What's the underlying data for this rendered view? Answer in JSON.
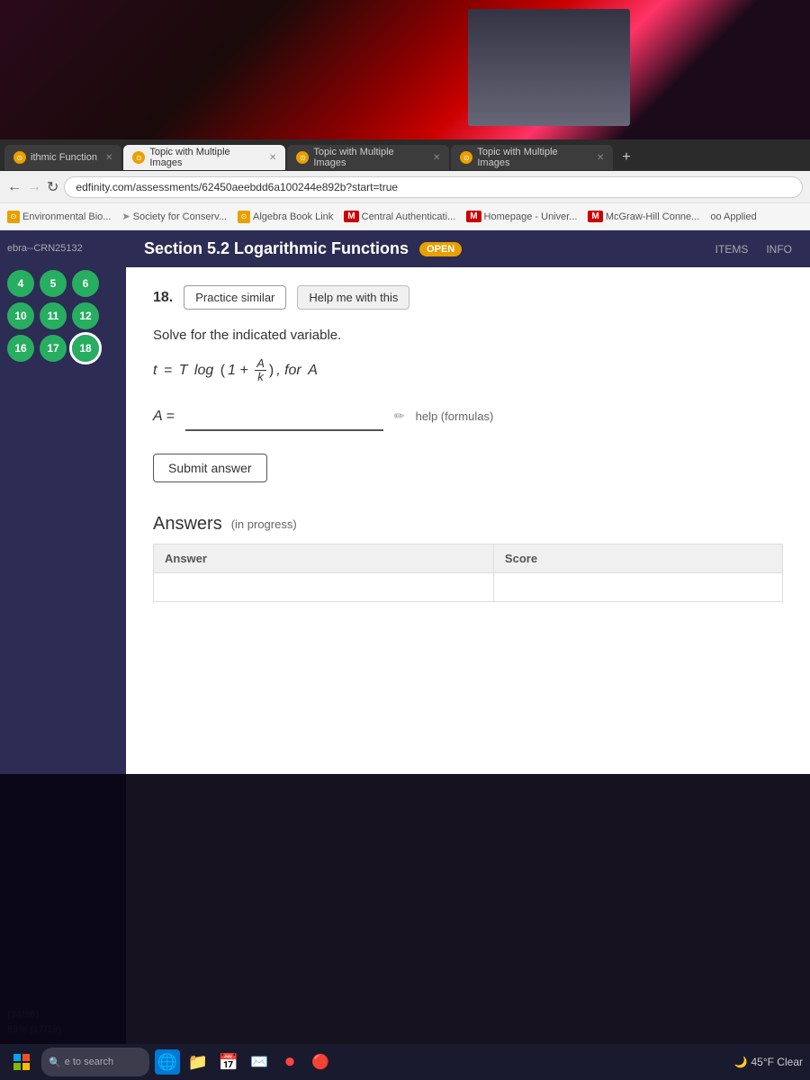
{
  "top_area": {
    "description": "Camera/video background area"
  },
  "browser": {
    "tabs": [
      {
        "id": "tab1",
        "label": "ithmic Function",
        "active": false,
        "closable": true
      },
      {
        "id": "tab2",
        "label": "Topic with Multiple Images",
        "active": true,
        "closable": true
      },
      {
        "id": "tab3",
        "label": "Topic with Multiple Images",
        "active": false,
        "closable": true
      },
      {
        "id": "tab4",
        "label": "Topic with Multiple Images",
        "active": false,
        "closable": true
      }
    ],
    "address": "edfinity.com/assessments/62450aeebdd6a100244e892b?start=true",
    "bookmarks": [
      {
        "label": "Environmental Bio..."
      },
      {
        "label": "Society for Conserv..."
      },
      {
        "label": "Algebra Book Link"
      },
      {
        "label": "Central Authenticati..."
      },
      {
        "label": "Homepage - Univer..."
      },
      {
        "label": "McGraw-Hill Conne..."
      },
      {
        "label": "oo Applied"
      }
    ]
  },
  "page": {
    "section_title": "Section 5.2 Logarithmic Functions",
    "section_badge": "OPEN",
    "crn_label": "ebra--CRN25132",
    "items_label": "ITEMS",
    "info_label": "INFO",
    "problem_number": "18.",
    "btn_practice": "Practice similar",
    "btn_help": "Help me with this",
    "instruction": "Solve for the indicated variable.",
    "formula": "t = T log(1 + A/k), for A",
    "answer_label": "A =",
    "answer_placeholder": "",
    "help_formulas": "help (formulas)",
    "btn_submit": "Submit answer",
    "answers_title": "Answers",
    "answers_in_progress": "(in progress)",
    "answers_col_answer": "Answer",
    "answers_col_score": "Score",
    "score_label": "(34/36)",
    "percent_label": "89% (17/19)"
  },
  "sidebar": {
    "items": [
      {
        "number": "4",
        "state": "green"
      },
      {
        "number": "5",
        "state": "green"
      },
      {
        "number": "6",
        "state": "green"
      },
      {
        "number": "10",
        "state": "green"
      },
      {
        "number": "11",
        "state": "green"
      },
      {
        "number": "12",
        "state": "green"
      },
      {
        "number": "16",
        "state": "green"
      },
      {
        "number": "17",
        "state": "green"
      },
      {
        "number": "18",
        "state": "active"
      }
    ],
    "score": "(34/36)",
    "percent": "89% (17/19)",
    "to_search": "e to search"
  },
  "taskbar": {
    "weather": "45°F Clear",
    "icons": [
      "🖥️",
      "🌐",
      "📁",
      "📅",
      "✉️",
      "🎵",
      "🔴"
    ]
  }
}
